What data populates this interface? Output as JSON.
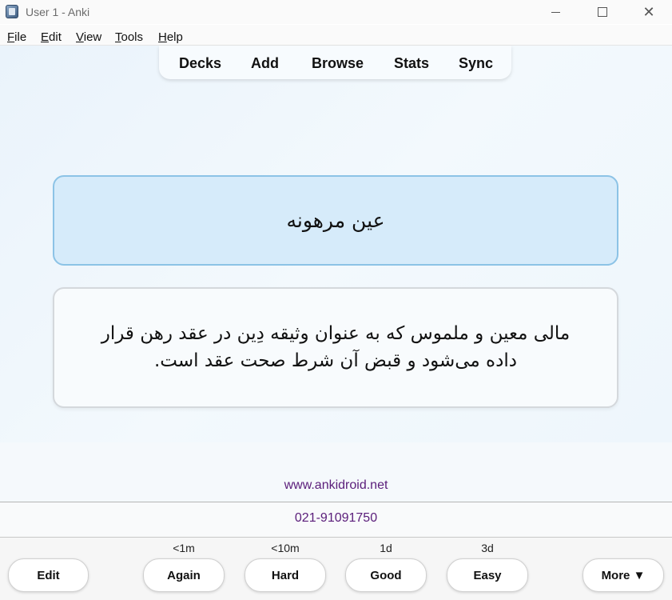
{
  "window": {
    "title": "User 1 - Anki"
  },
  "menu": [
    {
      "key": "F",
      "rest": "ile"
    },
    {
      "key": "E",
      "rest": "dit"
    },
    {
      "key": "V",
      "rest": "iew"
    },
    {
      "key": "T",
      "rest": "ools"
    },
    {
      "key": "H",
      "rest": "elp"
    }
  ],
  "toolbar": {
    "decks": "Decks",
    "add": "Add",
    "browse": "Browse",
    "stats": "Stats",
    "sync": "Sync"
  },
  "card": {
    "front": "عین مرهونه",
    "back": "مالی معین و ملموس که به عنوان وثیقه دِین در عقد رهن قرار داده می‌شود و قبض آن شرط صحت عقد است."
  },
  "footer": {
    "website": "www.ankidroid.net",
    "phone": "021-91091750"
  },
  "answer_bar": {
    "edit": "Edit",
    "again": {
      "label": "Again",
      "interval": "<1m"
    },
    "hard": {
      "label": "Hard",
      "interval": "<10m"
    },
    "good": {
      "label": "Good",
      "interval": "1d"
    },
    "easy": {
      "label": "Easy",
      "interval": "3d"
    },
    "more": "More ▼"
  },
  "colors": {
    "front_card_bg": "#d6ebfa",
    "front_card_border": "#8cc3e6",
    "link_purple": "#5a1d7a"
  }
}
